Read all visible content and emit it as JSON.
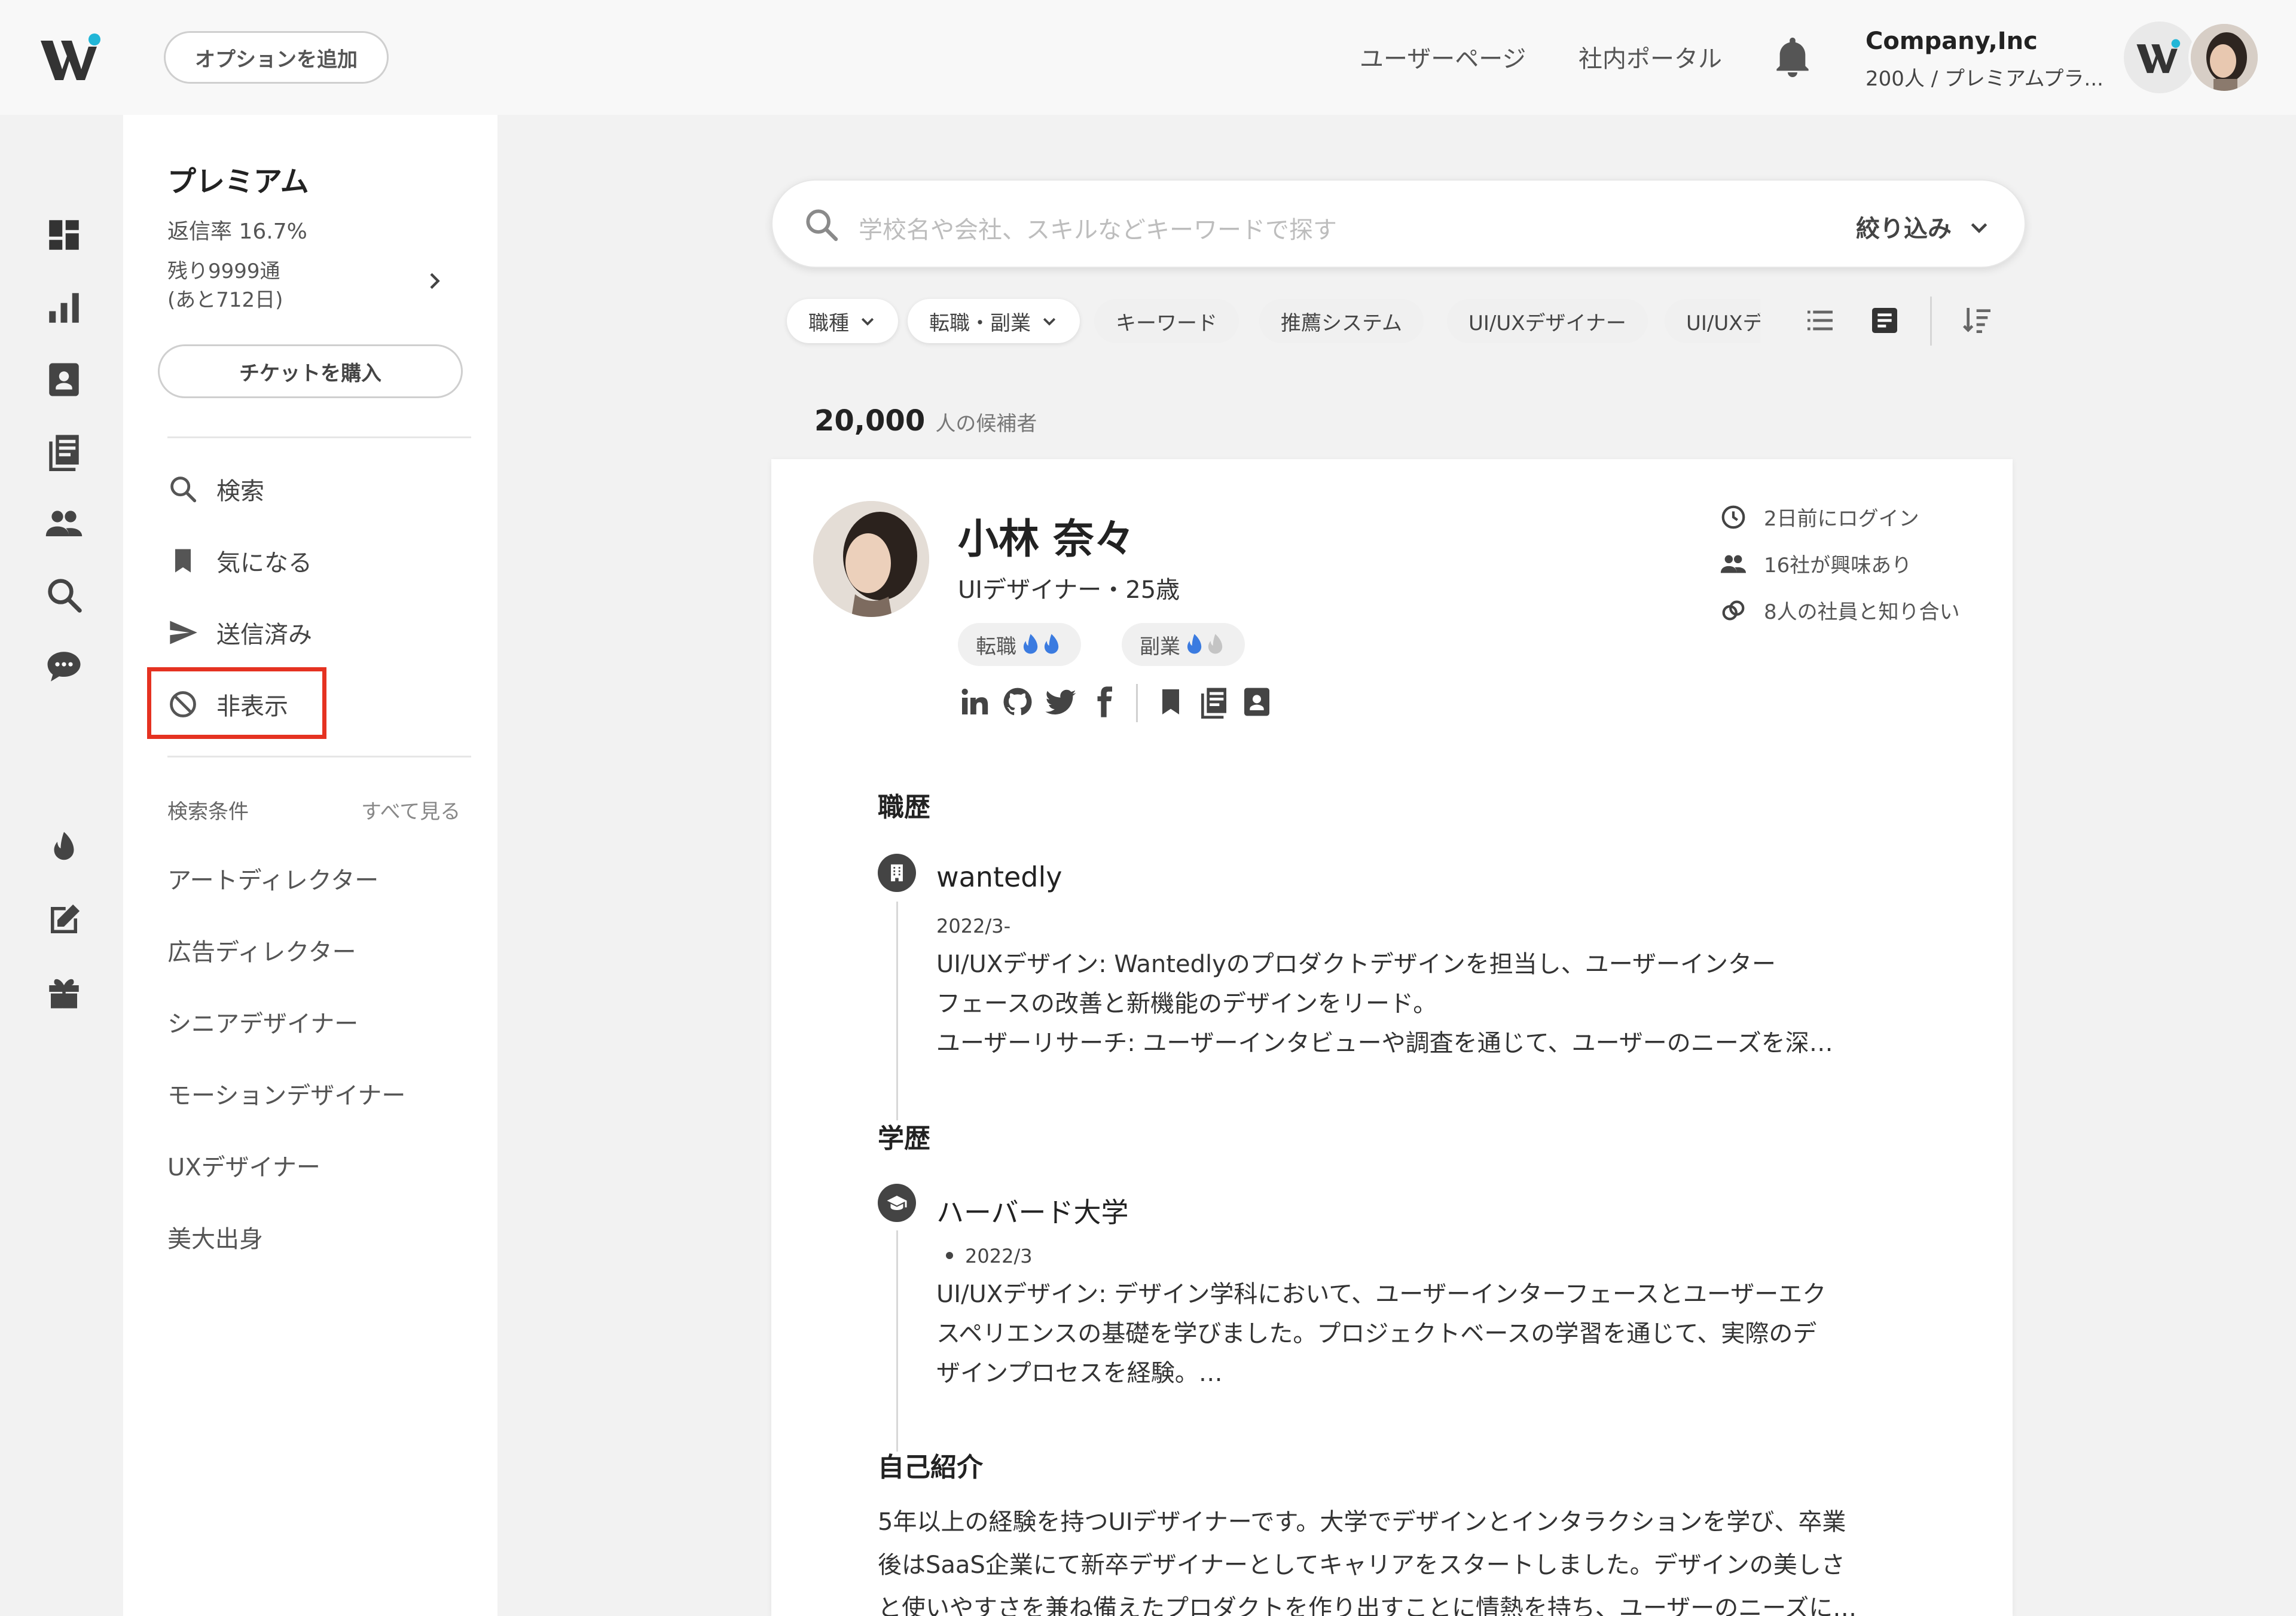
{
  "header": {
    "add_option": "オプションを追加",
    "links": [
      "ユーザーページ",
      "社内ポータル"
    ],
    "company_name": "Company,Inc",
    "company_plan": "200人 / プレミアムプラ..."
  },
  "rail_icons": [
    "dashboard-icon",
    "analytics-icon",
    "profile-card-icon",
    "article-icon",
    "people-icon",
    "search-icon",
    "chat-icon",
    "fire-icon",
    "edit-icon",
    "gift-icon"
  ],
  "sidebar": {
    "plan_title": "プレミアム",
    "reply_rate": "返信率 16.7%",
    "remaining_line1": "残り9999通",
    "remaining_line2": "(あと712日)",
    "ticket_button": "チケットを購入",
    "nav": [
      {
        "label": "検索",
        "icon": "search-icon"
      },
      {
        "label": "気になる",
        "icon": "bookmark-icon"
      },
      {
        "label": "送信済み",
        "icon": "send-icon"
      },
      {
        "label": "非表示",
        "icon": "hidden-icon"
      }
    ],
    "conditions_header": "検索条件",
    "see_all": "すべて見る",
    "conditions": [
      "アートディレクター",
      "広告ディレクター",
      "シニアデザイナー",
      "モーションデザイナー",
      "UXデザイナー",
      "美大出身"
    ]
  },
  "search": {
    "placeholder": "学校名や会社、スキルなどキーワードで探す",
    "filter_label": "絞り込み"
  },
  "chips": [
    "職種",
    "転職・副業",
    "キーワード",
    "推薦システム",
    "UI/UXデザイナー",
    "UI/UXデ"
  ],
  "results": {
    "count": "20,000",
    "label": "人の候補者"
  },
  "candidate": {
    "name": "小林 奈々",
    "role": "UIデザイナー・25歳",
    "tags": [
      "転職",
      "副業"
    ],
    "meta": [
      "2日前にログイン",
      "16社が興味あり",
      "8人の社員と知り合い"
    ],
    "career_title": "職歴",
    "career": {
      "org": "wantedly",
      "period": "2022/3-",
      "lines": [
        "UI/UXデザイン: Wantedlyのプロダクトデザインを担当し、ユーザーインター",
        "フェースの改善と新機能のデザインをリード。",
        "ユーザーリサーチ: ユーザーインタビューや調査を通じて、ユーザーのニーズを深…"
      ]
    },
    "education_title": "学歴",
    "education": {
      "org": "ハーバード大学",
      "period": "2022/3",
      "lines": [
        "UI/UXデザイン: デザイン学科において、ユーザーインターフェースとユーザーエク",
        "スペリエンスの基礎を学びました。プロジェクトベースの学習を通じて、実際のデ",
        "ザインプロセスを経験。…"
      ]
    },
    "intro_title": "自己紹介",
    "intro_lines": [
      "5年以上の経験を持つUIデザイナーです。大学でデザインとインタラクションを学び、卒業",
      "後はSaaS企業にて新卒デザイナーとしてキャリアをスタートしました。デザインの美しさ",
      "と使いやすさを兼ね備えたプロダクトを作り出すことに情熱を持ち、ユーザーのニーズに…"
    ]
  },
  "colors": {
    "highlight": "#e53221",
    "brand_accent": "#21b6d7",
    "flame_blue": "#3b7be0"
  }
}
